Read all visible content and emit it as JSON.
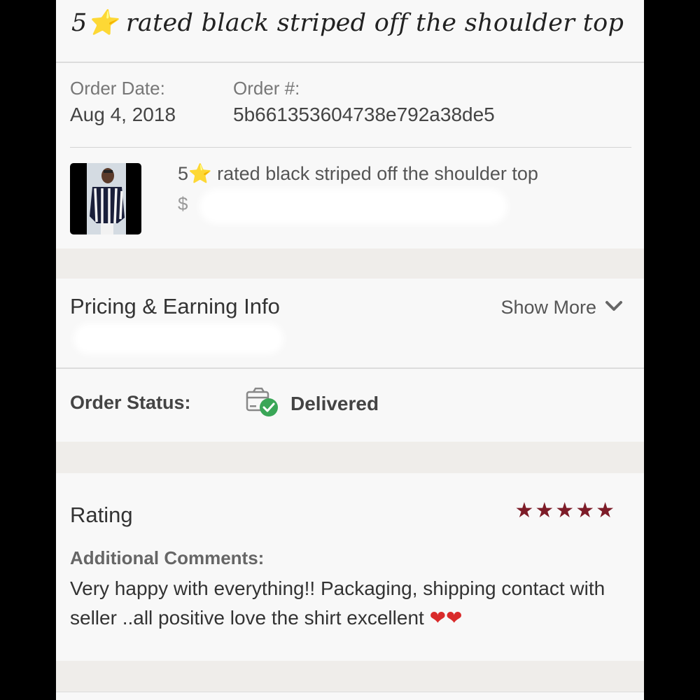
{
  "header": {
    "rating_number": "5",
    "star_glyph": "⭐",
    "title_text": " rated black striped off the shoulder top"
  },
  "order": {
    "date_label": "Order Date:",
    "date_value": "Aug 4, 2018",
    "number_label": "Order #:",
    "number_value": "5b661353604738e792a38de5"
  },
  "product": {
    "thumbnail_icon": "product-photo",
    "title_number": "5",
    "star_glyph": "⭐",
    "title_text": " rated black striped off the shoulder top",
    "price_partial": "$"
  },
  "pricing": {
    "title": "Pricing & Earning Info",
    "show_more_label": "Show More",
    "chevron_icon": "chevron-down-icon"
  },
  "status": {
    "label": "Order Status:",
    "value": "Delivered",
    "icon": "package-delivered-icon",
    "check_color": "#3aa657"
  },
  "rating": {
    "title": "Rating",
    "stars": "★★★★★",
    "stars_filled": 5,
    "stars_total": 5,
    "star_color": "#7d1c28",
    "comments_label": "Additional Comments:",
    "comments_text": "Very happy with everything!! Packaging, shipping contact with seller ..all positive love the shirt excellent ",
    "hearts": "❤❤"
  }
}
